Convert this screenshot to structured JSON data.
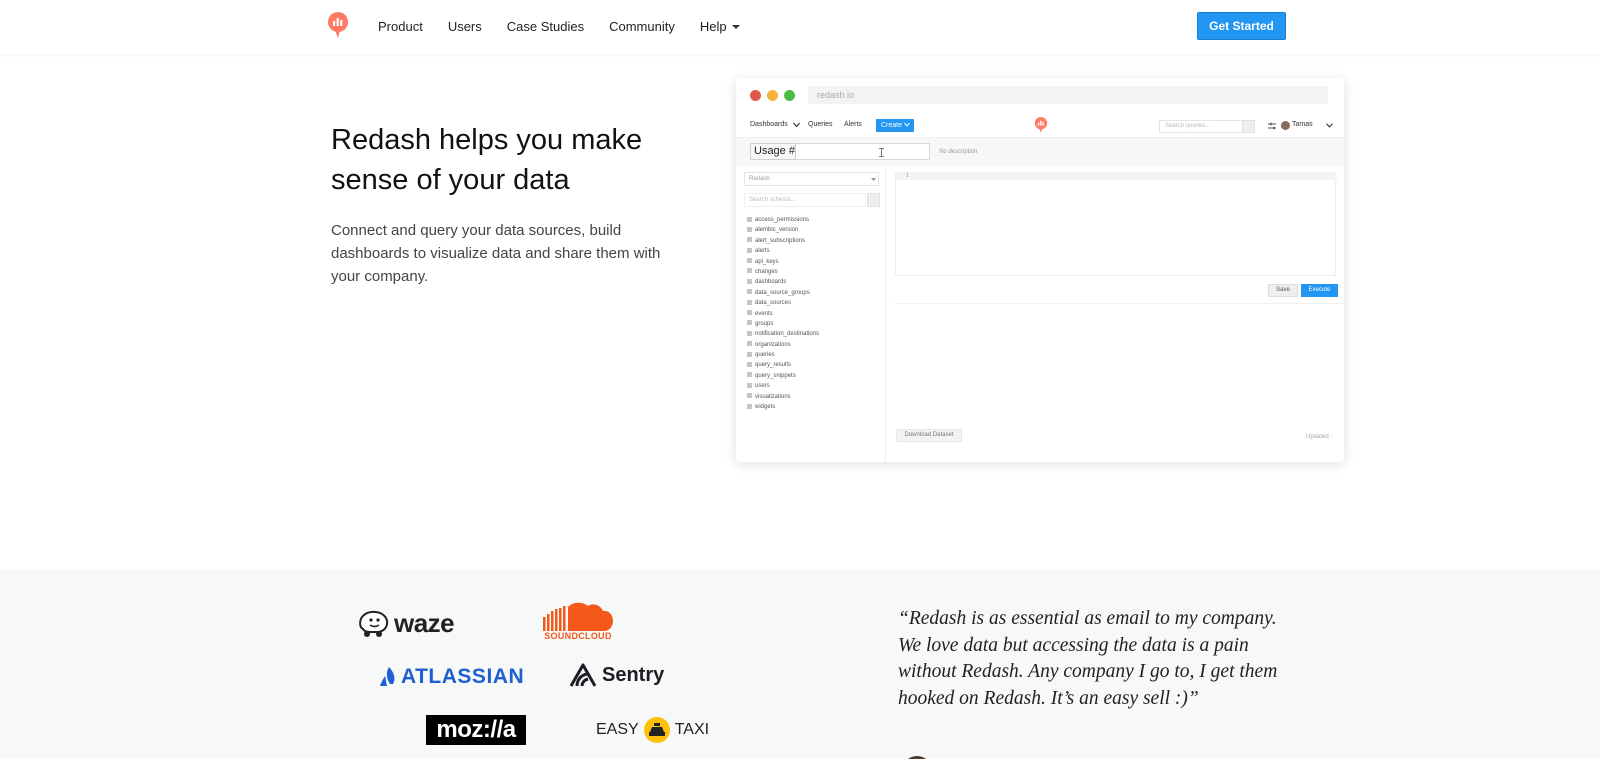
{
  "nav": {
    "items": [
      {
        "label": "Product"
      },
      {
        "label": "Users"
      },
      {
        "label": "Case Studies"
      },
      {
        "label": "Community"
      },
      {
        "label": "Help"
      }
    ],
    "cta_label": "Get Started"
  },
  "hero": {
    "title": "Redash helps you make sense of your data",
    "subtitle": "Connect and query your data sources, build dashboards to visualize data and share them with your company."
  },
  "mock": {
    "url": "redash.io",
    "appbar": {
      "dashboards": "Dashboards",
      "queries": "Queries",
      "alerts": "Alerts",
      "create": "Create",
      "search_placeholder": "Search queries...",
      "user": "Tamas"
    },
    "query_name": "Usage #",
    "description": "No description",
    "datasource": "Redash",
    "schema_search_placeholder": "Search schema...",
    "tables": [
      "access_permissions",
      "alembic_version",
      "alert_subscriptions",
      "alerts",
      "api_keys",
      "changes",
      "dashboards",
      "data_source_groups",
      "data_sources",
      "events",
      "groups",
      "notification_destinations",
      "organizations",
      "queries",
      "query_results",
      "query_snippets",
      "users",
      "visualizations",
      "widgets"
    ],
    "line_number": "1",
    "save_label": "Save",
    "execute_label": "Execute",
    "download_label": "Download Dataset",
    "updated_label": "Updated -"
  },
  "strip": {
    "logos": {
      "waze": "waze",
      "soundcloud": "SOUNDCLOUD",
      "atlassian": "ATLASSIAN",
      "sentry": "Sentry",
      "mozilla": "moz://a",
      "easytaxi_left": "EASY",
      "easytaxi_right": "TAXI"
    },
    "quote": "“Redash is as essential as email to my company. We love data but accessing the data is a pain without Redash. Any company I go to, I get them hooked on Redash. It’s an easy sell :)”"
  },
  "colors": {
    "brand": "#ff7964",
    "accent": "#2196f3"
  }
}
